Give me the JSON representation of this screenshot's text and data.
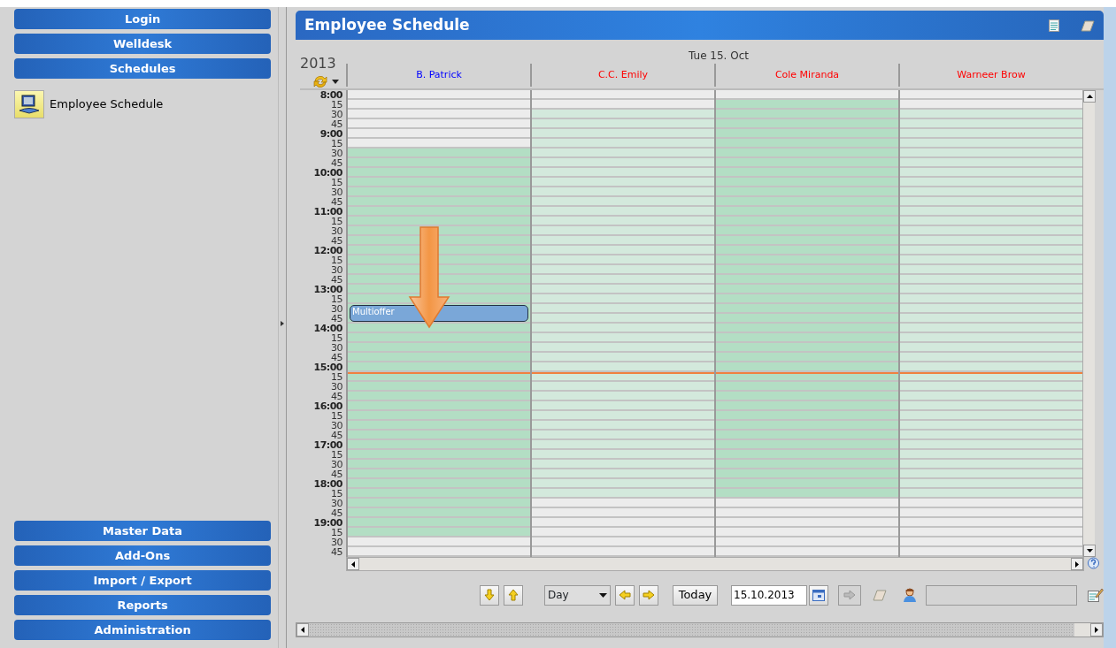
{
  "top_menu": [
    {
      "label": "Login"
    },
    {
      "label": "Welldesk"
    },
    {
      "label": "Schedules"
    }
  ],
  "sidebar_items": [
    {
      "label": "Employee Schedule"
    }
  ],
  "bottom_menu": [
    {
      "label": "Master Data"
    },
    {
      "label": "Add-Ons"
    },
    {
      "label": "Import / Export"
    },
    {
      "label": "Reports"
    },
    {
      "label": "Administration"
    }
  ],
  "panel": {
    "title": "Employee Schedule"
  },
  "calendar": {
    "year": "2013",
    "date_heading": "Tue 15. Oct",
    "columns": [
      {
        "name": "B. Patrick",
        "color": "#0000ff",
        "highlighted": true
      },
      {
        "name": "C.C. Emily",
        "color": "#ff0000",
        "highlighted": false
      },
      {
        "name": "Cole Miranda",
        "color": "#ff0000",
        "highlighted": true
      },
      {
        "name": "Warneer Brow",
        "color": "#ff0000",
        "highlighted": false
      }
    ],
    "rows": [
      {
        "label": "8:00",
        "kind": "hour",
        "now": false,
        "cells": [
          {
            "available": false
          },
          {
            "available": false
          },
          {
            "available": false
          },
          {
            "available": false
          }
        ]
      },
      {
        "label": "15",
        "kind": "quarter",
        "now": false,
        "cells": [
          {
            "available": false
          },
          {
            "available": false
          },
          {
            "available": true
          },
          {
            "available": false
          }
        ]
      },
      {
        "label": "30",
        "kind": "quarter",
        "now": false,
        "cells": [
          {
            "available": false
          },
          {
            "available": true
          },
          {
            "available": true
          },
          {
            "available": true
          }
        ]
      },
      {
        "label": "45",
        "kind": "quarter",
        "now": false,
        "cells": [
          {
            "available": false
          },
          {
            "available": true
          },
          {
            "available": true
          },
          {
            "available": true
          }
        ]
      },
      {
        "label": "9:00",
        "kind": "hour",
        "now": false,
        "cells": [
          {
            "available": false
          },
          {
            "available": true
          },
          {
            "available": true
          },
          {
            "available": true
          }
        ]
      },
      {
        "label": "15",
        "kind": "quarter",
        "now": false,
        "cells": [
          {
            "available": false
          },
          {
            "available": true
          },
          {
            "available": true
          },
          {
            "available": true
          }
        ]
      },
      {
        "label": "30",
        "kind": "quarter",
        "now": false,
        "cells": [
          {
            "available": true
          },
          {
            "available": true
          },
          {
            "available": true
          },
          {
            "available": true
          }
        ]
      },
      {
        "label": "45",
        "kind": "quarter",
        "now": false,
        "cells": [
          {
            "available": true
          },
          {
            "available": true
          },
          {
            "available": true
          },
          {
            "available": true
          }
        ]
      },
      {
        "label": "10:00",
        "kind": "hour",
        "now": false,
        "cells": [
          {
            "available": true
          },
          {
            "available": true
          },
          {
            "available": true
          },
          {
            "available": true
          }
        ]
      },
      {
        "label": "15",
        "kind": "quarter",
        "now": false,
        "cells": [
          {
            "available": true
          },
          {
            "available": true
          },
          {
            "available": true
          },
          {
            "available": true
          }
        ]
      },
      {
        "label": "30",
        "kind": "quarter",
        "now": false,
        "cells": [
          {
            "available": true
          },
          {
            "available": true
          },
          {
            "available": true
          },
          {
            "available": true
          }
        ]
      },
      {
        "label": "45",
        "kind": "quarter",
        "now": false,
        "cells": [
          {
            "available": true
          },
          {
            "available": true
          },
          {
            "available": true
          },
          {
            "available": true
          }
        ]
      },
      {
        "label": "11:00",
        "kind": "hour",
        "now": false,
        "cells": [
          {
            "available": true
          },
          {
            "available": true
          },
          {
            "available": true
          },
          {
            "available": true
          }
        ]
      },
      {
        "label": "15",
        "kind": "quarter",
        "now": false,
        "cells": [
          {
            "available": true
          },
          {
            "available": true
          },
          {
            "available": true
          },
          {
            "available": true
          }
        ]
      },
      {
        "label": "30",
        "kind": "quarter",
        "now": false,
        "cells": [
          {
            "available": true
          },
          {
            "available": true
          },
          {
            "available": true
          },
          {
            "available": true
          }
        ]
      },
      {
        "label": "45",
        "kind": "quarter",
        "now": false,
        "cells": [
          {
            "available": true
          },
          {
            "available": true
          },
          {
            "available": true
          },
          {
            "available": true
          }
        ]
      },
      {
        "label": "12:00",
        "kind": "hour",
        "now": false,
        "cells": [
          {
            "available": true
          },
          {
            "available": true
          },
          {
            "available": true
          },
          {
            "available": true
          }
        ]
      },
      {
        "label": "15",
        "kind": "quarter",
        "now": false,
        "cells": [
          {
            "available": true
          },
          {
            "available": true
          },
          {
            "available": true
          },
          {
            "available": true
          }
        ]
      },
      {
        "label": "30",
        "kind": "quarter",
        "now": false,
        "cells": [
          {
            "available": true
          },
          {
            "available": true
          },
          {
            "available": true
          },
          {
            "available": true
          }
        ]
      },
      {
        "label": "45",
        "kind": "quarter",
        "now": false,
        "cells": [
          {
            "available": true
          },
          {
            "available": true
          },
          {
            "available": true
          },
          {
            "available": true
          }
        ]
      },
      {
        "label": "13:00",
        "kind": "hour",
        "now": false,
        "cells": [
          {
            "available": true
          },
          {
            "available": true
          },
          {
            "available": true
          },
          {
            "available": true
          }
        ]
      },
      {
        "label": "15",
        "kind": "quarter",
        "now": false,
        "cells": [
          {
            "available": true
          },
          {
            "available": true
          },
          {
            "available": true
          },
          {
            "available": true
          }
        ]
      },
      {
        "label": "30",
        "kind": "quarter",
        "now": false,
        "cells": [
          {
            "available": true,
            "event": "Multioffer"
          },
          {
            "available": true
          },
          {
            "available": true
          },
          {
            "available": true
          }
        ]
      },
      {
        "label": "45",
        "kind": "quarter",
        "now": false,
        "cells": [
          {
            "available": true
          },
          {
            "available": true
          },
          {
            "available": true
          },
          {
            "available": true
          }
        ]
      },
      {
        "label": "14:00",
        "kind": "hour",
        "now": false,
        "cells": [
          {
            "available": true
          },
          {
            "available": true
          },
          {
            "available": true
          },
          {
            "available": true
          }
        ]
      },
      {
        "label": "15",
        "kind": "quarter",
        "now": false,
        "cells": [
          {
            "available": true
          },
          {
            "available": true
          },
          {
            "available": true
          },
          {
            "available": true
          }
        ]
      },
      {
        "label": "30",
        "kind": "quarter",
        "now": false,
        "cells": [
          {
            "available": true
          },
          {
            "available": true
          },
          {
            "available": true
          },
          {
            "available": true
          }
        ]
      },
      {
        "label": "45",
        "kind": "quarter",
        "now": false,
        "cells": [
          {
            "available": true
          },
          {
            "available": true
          },
          {
            "available": true
          },
          {
            "available": true
          }
        ]
      },
      {
        "label": "15:00",
        "kind": "hour",
        "now": false,
        "cells": [
          {
            "available": true
          },
          {
            "available": true
          },
          {
            "available": true
          },
          {
            "available": true
          }
        ]
      },
      {
        "label": "15",
        "kind": "quarter",
        "now": true,
        "cells": [
          {
            "available": true
          },
          {
            "available": true
          },
          {
            "available": true
          },
          {
            "available": true
          }
        ]
      },
      {
        "label": "30",
        "kind": "quarter",
        "now": false,
        "cells": [
          {
            "available": true
          },
          {
            "available": true
          },
          {
            "available": true
          },
          {
            "available": true
          }
        ]
      },
      {
        "label": "45",
        "kind": "quarter",
        "now": false,
        "cells": [
          {
            "available": true
          },
          {
            "available": true
          },
          {
            "available": true
          },
          {
            "available": true
          }
        ]
      },
      {
        "label": "16:00",
        "kind": "hour",
        "now": false,
        "cells": [
          {
            "available": true
          },
          {
            "available": true
          },
          {
            "available": true
          },
          {
            "available": true
          }
        ]
      },
      {
        "label": "15",
        "kind": "quarter",
        "now": false,
        "cells": [
          {
            "available": true
          },
          {
            "available": true
          },
          {
            "available": true
          },
          {
            "available": true
          }
        ]
      },
      {
        "label": "30",
        "kind": "quarter",
        "now": false,
        "cells": [
          {
            "available": true
          },
          {
            "available": true
          },
          {
            "available": true
          },
          {
            "available": true
          }
        ]
      },
      {
        "label": "45",
        "kind": "quarter",
        "now": false,
        "cells": [
          {
            "available": true
          },
          {
            "available": true
          },
          {
            "available": true
          },
          {
            "available": true
          }
        ]
      },
      {
        "label": "17:00",
        "kind": "hour",
        "now": false,
        "cells": [
          {
            "available": true
          },
          {
            "available": true
          },
          {
            "available": true
          },
          {
            "available": true
          }
        ]
      },
      {
        "label": "15",
        "kind": "quarter",
        "now": false,
        "cells": [
          {
            "available": true
          },
          {
            "available": true
          },
          {
            "available": true
          },
          {
            "available": true
          }
        ]
      },
      {
        "label": "30",
        "kind": "quarter",
        "now": false,
        "cells": [
          {
            "available": true
          },
          {
            "available": true
          },
          {
            "available": true
          },
          {
            "available": true
          }
        ]
      },
      {
        "label": "45",
        "kind": "quarter",
        "now": false,
        "cells": [
          {
            "available": true
          },
          {
            "available": true
          },
          {
            "available": true
          },
          {
            "available": true
          }
        ]
      },
      {
        "label": "18:00",
        "kind": "hour",
        "now": false,
        "cells": [
          {
            "available": true
          },
          {
            "available": true
          },
          {
            "available": true
          },
          {
            "available": true
          }
        ]
      },
      {
        "label": "15",
        "kind": "quarter",
        "now": false,
        "cells": [
          {
            "available": true
          },
          {
            "available": true
          },
          {
            "available": true
          },
          {
            "available": true
          }
        ]
      },
      {
        "label": "30",
        "kind": "quarter",
        "now": false,
        "cells": [
          {
            "available": true
          },
          {
            "available": false
          },
          {
            "available": false
          },
          {
            "available": false
          }
        ]
      },
      {
        "label": "45",
        "kind": "quarter",
        "now": false,
        "cells": [
          {
            "available": true
          },
          {
            "available": false
          },
          {
            "available": false
          },
          {
            "available": false
          }
        ]
      },
      {
        "label": "19:00",
        "kind": "hour",
        "now": false,
        "cells": [
          {
            "available": true
          },
          {
            "available": false
          },
          {
            "available": false
          },
          {
            "available": false
          }
        ]
      },
      {
        "label": "15",
        "kind": "quarter",
        "now": false,
        "cells": [
          {
            "available": true
          },
          {
            "available": false
          },
          {
            "available": false
          },
          {
            "available": false
          }
        ]
      },
      {
        "label": "30",
        "kind": "quarter",
        "now": false,
        "cells": [
          {
            "available": false
          },
          {
            "available": false
          },
          {
            "available": false
          },
          {
            "available": false
          }
        ]
      },
      {
        "label": "45",
        "kind": "quarter",
        "now": false,
        "cells": [
          {
            "available": false
          },
          {
            "available": false
          },
          {
            "available": false
          },
          {
            "available": false
          }
        ]
      }
    ]
  },
  "toolbar": {
    "view": "Day",
    "today": "Today",
    "date": "15.10.2013",
    "go_disabled": true
  }
}
